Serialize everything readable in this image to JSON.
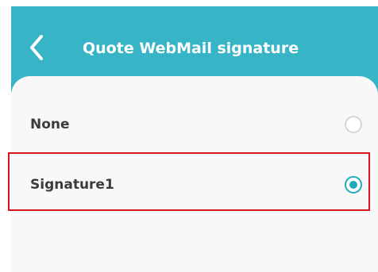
{
  "header": {
    "title": "Quote WebMail signature",
    "back_icon": "chevron-left-icon",
    "background_color": "#37b5c6"
  },
  "options": [
    {
      "label": "None",
      "selected": false
    },
    {
      "label": "Signature1",
      "selected": true
    }
  ],
  "colors": {
    "accent": "#22a9be",
    "highlight_border": "#d8141e",
    "content_background": "#f8f8f8"
  }
}
